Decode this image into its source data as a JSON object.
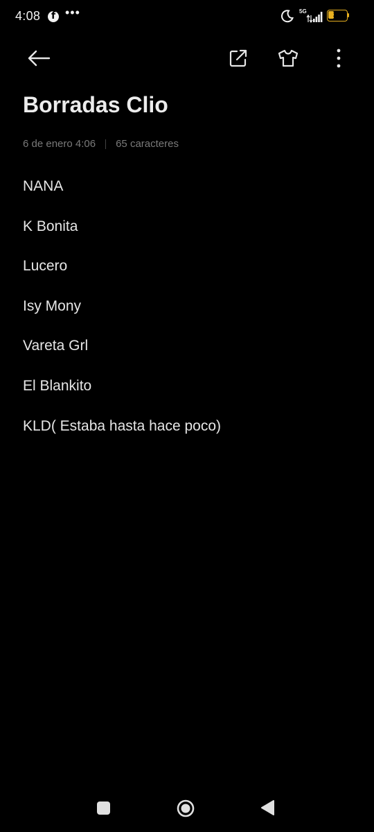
{
  "status_bar": {
    "time": "4:08",
    "notification_icons": [
      "facebook-icon",
      "more-notifications-icon"
    ],
    "more_label": "•••",
    "network": "5G",
    "battery_level": 32,
    "battery_label": "32",
    "battery_color": "#e8b020"
  },
  "toolbar": {
    "icons": [
      "back-arrow-icon",
      "share-icon",
      "theme-shirt-icon",
      "more-vertical-icon"
    ]
  },
  "note": {
    "title": "Borradas Clio",
    "date": "6 de enero 4:06",
    "char_count": "65 caracteres",
    "lines": [
      "NANA",
      "K Bonita",
      "Lucero",
      "Isy Mony",
      "Vareta Grl",
      "El Blankito",
      "KLD( Estaba hasta hace poco)"
    ]
  },
  "nav_bar": {
    "icons": [
      "recent-apps-icon",
      "home-icon",
      "back-triangle-icon"
    ]
  },
  "colors": {
    "background": "#000000",
    "text": "#e6e6e6",
    "meta_text": "#7a7a7a"
  }
}
